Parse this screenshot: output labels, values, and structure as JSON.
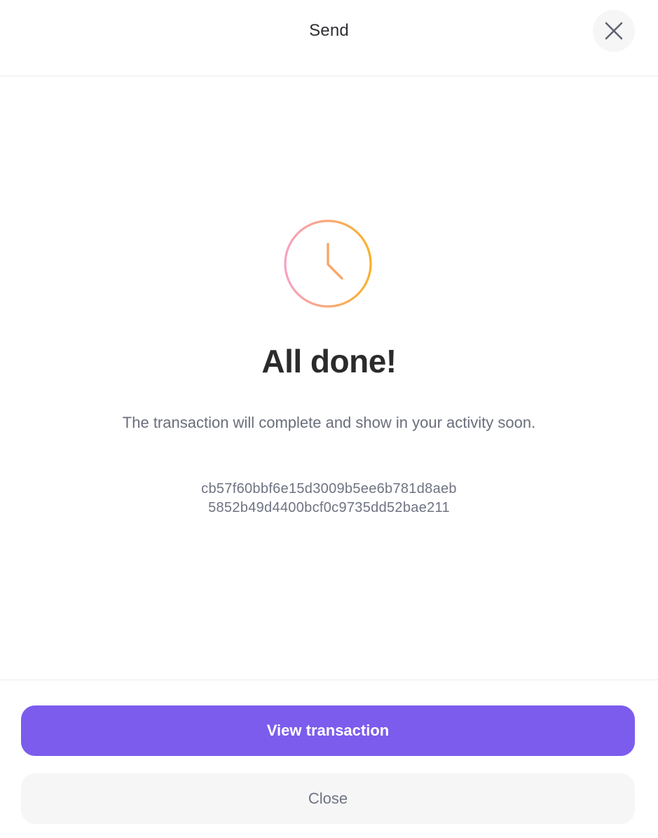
{
  "header": {
    "title": "Send",
    "close_icon": "close-icon"
  },
  "status": {
    "icon": "clock-icon",
    "icon_gradient": [
      "#f7a1c4",
      "#f9b12b"
    ],
    "title": "All done!",
    "message": "The transaction will complete and show in your activity soon."
  },
  "transaction": {
    "hash_line_1": "cb57f60bbf6e15d3009b5ee6b781d8aeb",
    "hash_line_2": "5852b49d4400bcf0c9735dd52bae211"
  },
  "footer": {
    "view_label": "View transaction",
    "close_label": "Close"
  },
  "colors": {
    "accent": "#7b5ced",
    "text_dark": "#2b2b2b",
    "text_muted": "#6f7382"
  }
}
